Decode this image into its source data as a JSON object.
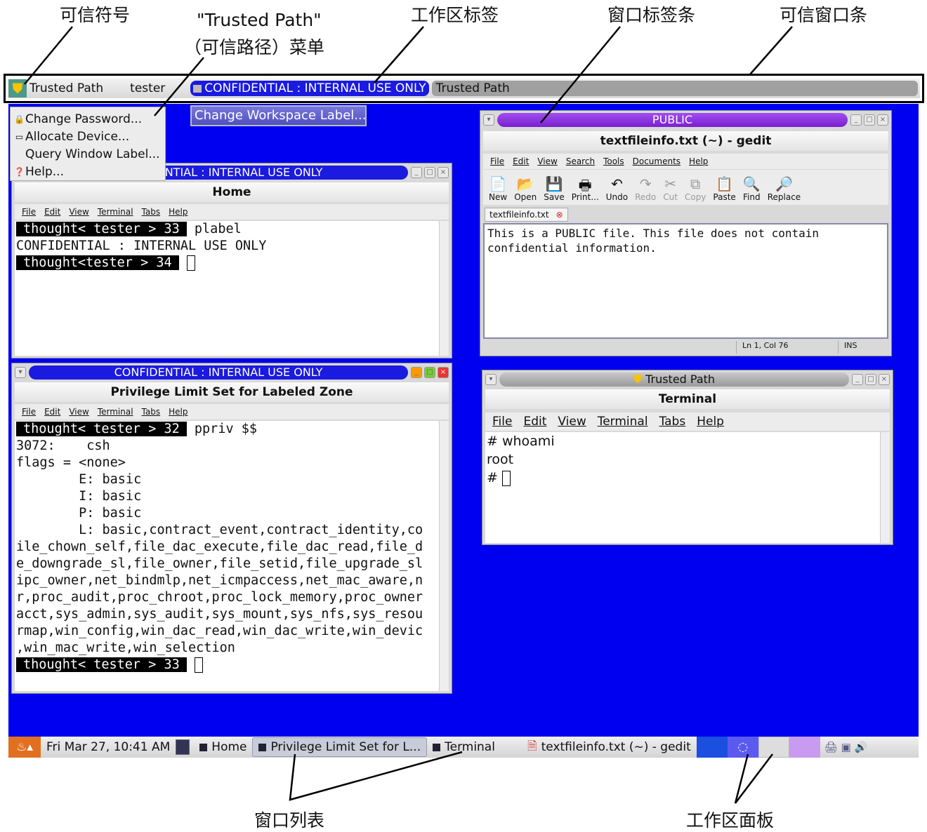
{
  "annotations": {
    "trusted_symbol": "可信符号",
    "trusted_path_menu_1": "\"Trusted Path\"",
    "trusted_path_menu_2": "（可信路径）菜单",
    "workspace_label": "工作区标签",
    "window_label_bar": "窗口标签条",
    "trusted_stripe": "可信窗口条",
    "window_list": "窗口列表",
    "workspace_panel": "工作区面板"
  },
  "topbar": {
    "trusted_path": "Trusted Path",
    "user": "tester",
    "workspace_label": "CONFIDENTIAL : INTERNAL USE ONLY",
    "window_label": "Trusted Path"
  },
  "menu": {
    "items": [
      {
        "label": "Change Password...",
        "icon": "lock-icon"
      },
      {
        "label": "Allocate Device...",
        "icon": "device-icon"
      },
      {
        "label": "Query Window Label...",
        "icon": ""
      },
      {
        "label": "Help...",
        "icon": "help-icon"
      }
    ]
  },
  "change_workspace_label": "Change Workspace Label...",
  "colors": {
    "desktop": "#0000f0",
    "confidential": "#1a1ae0",
    "public": "#8a2be2",
    "trusted": "#a8a8a8"
  },
  "home_window": {
    "label": "CONFIDENTIAL : INTERNAL USE ONLY",
    "title": "Home",
    "menu": [
      "File",
      "Edit",
      "View",
      "Terminal",
      "Tabs",
      "Help"
    ],
    "lines": [
      {
        "prompt": "thought< tester > 33",
        "text": " plabel"
      },
      {
        "text": "CONFIDENTIAL : INTERNAL USE ONLY"
      },
      {
        "prompt": "thought<tester > 34",
        "text": " ",
        "cursor": true
      }
    ]
  },
  "priv_window": {
    "label": "CONFIDENTIAL : INTERNAL USE ONLY",
    "title": "Privilege Limit Set for Labeled Zone",
    "menu": [
      "File",
      "Edit",
      "View",
      "Terminal",
      "Tabs",
      "Help"
    ],
    "lines": [
      {
        "prompt": "thought< tester > 32",
        "text": " ppriv $$"
      },
      {
        "text": "3072:    csh"
      },
      {
        "text": "flags = <none>"
      },
      {
        "text": "        E: basic"
      },
      {
        "text": "        I: basic"
      },
      {
        "text": "        P: basic"
      },
      {
        "text": "        L: basic,contract_event,contract_identity,co"
      },
      {
        "text": "ile_chown_self,file_dac_execute,file_dac_read,file_d"
      },
      {
        "text": "e_downgrade_sl,file_owner,file_setid,file_upgrade_sl"
      },
      {
        "text": "ipc_owner,net_bindmlp,net_icmpaccess,net_mac_aware,n"
      },
      {
        "text": "r,proc_audit,proc_chroot,proc_lock_memory,proc_owner"
      },
      {
        "text": "acct,sys_admin,sys_audit,sys_mount,sys_nfs,sys_resou"
      },
      {
        "text": "rmap,win_config,win_dac_read,win_dac_write,win_devic"
      },
      {
        "text": ",win_mac_write,win_selection"
      },
      {
        "prompt": "thought< tester > 33",
        "text": " ",
        "cursor": true
      }
    ]
  },
  "gedit_window": {
    "label": "PUBLIC",
    "title": "textfileinfo.txt (~) - gedit",
    "menu": [
      "File",
      "Edit",
      "View",
      "Search",
      "Tools",
      "Documents",
      "Help"
    ],
    "toolbar": [
      {
        "label": "New",
        "icon": "new-file-icon",
        "glyph": "📄"
      },
      {
        "label": "Open",
        "icon": "open-icon",
        "glyph": "📂"
      },
      {
        "label": "Save",
        "icon": "save-icon",
        "glyph": "💾"
      },
      {
        "label": "Print...",
        "icon": "print-icon",
        "glyph": "🖶"
      },
      {
        "label": "Undo",
        "icon": "undo-icon",
        "glyph": "↶"
      },
      {
        "label": "Redo",
        "icon": "redo-icon",
        "glyph": "↷",
        "disabled": true
      },
      {
        "label": "Cut",
        "icon": "cut-icon",
        "glyph": "✂",
        "disabled": true
      },
      {
        "label": "Copy",
        "icon": "copy-icon",
        "glyph": "⧉",
        "disabled": true
      },
      {
        "label": "Paste",
        "icon": "paste-icon",
        "glyph": "📋"
      },
      {
        "label": "Find",
        "icon": "find-icon",
        "glyph": "🔍"
      },
      {
        "label": "Replace",
        "icon": "replace-icon",
        "glyph": "🔎"
      }
    ],
    "tab": "textfileinfo.txt",
    "content": [
      "This is a PUBLIC file. This file does not contain",
      "confidential information."
    ],
    "status_pos": "Ln 1, Col 76",
    "status_mode": "INS"
  },
  "tp_terminal": {
    "label": "Trusted Path",
    "title": "Terminal",
    "menu": [
      "File",
      "Edit",
      "View",
      "Terminal",
      "Tabs",
      "Help"
    ],
    "lines": [
      "# whoami",
      "root",
      "# "
    ]
  },
  "panel": {
    "clock": "Fri Mar 27, 10:41 AM",
    "tasks": [
      "Home",
      "Privilege Limit Set for L...",
      "Terminal",
      "textfileinfo.txt (~) - gedit"
    ]
  }
}
